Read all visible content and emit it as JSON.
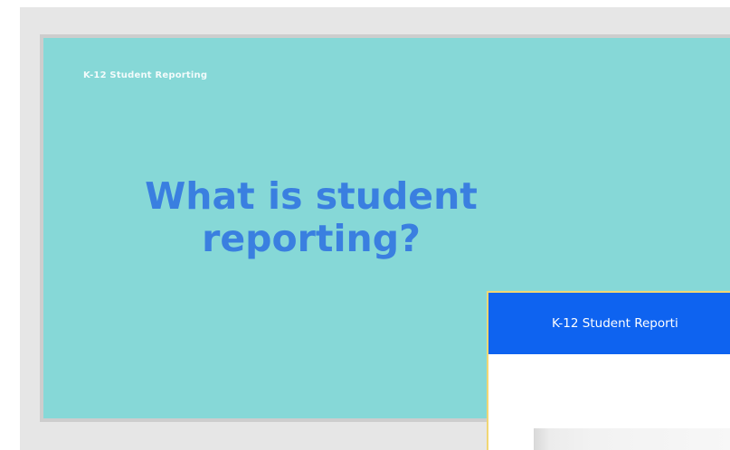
{
  "slide": {
    "kicker": "K-12 Student Reporting",
    "title": "What is student reporting?",
    "background": "#86d8d7",
    "title_color": "#3a7fe0"
  },
  "popup": {
    "title": "K-12 Student Reporti",
    "header_color": "#0e63f0",
    "border_color": "#f1d774"
  }
}
